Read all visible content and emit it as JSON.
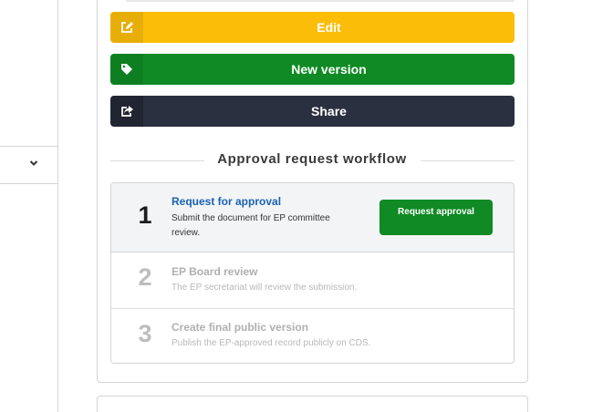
{
  "actions": {
    "edit_label": "Edit",
    "new_version_label": "New version",
    "share_label": "Share"
  },
  "workflow": {
    "title": "Approval request workflow",
    "steps": [
      {
        "number": "1",
        "title": "Request for approval",
        "description": "Submit the document for EP committee review.",
        "button_label": "Request approval"
      },
      {
        "number": "2",
        "title": "EP Board review",
        "description": "The EP secretariat will review the submission."
      },
      {
        "number": "3",
        "title": "Create final public version",
        "description": "Publish the EP-approved record publicly on CDS."
      }
    ]
  },
  "icons": {
    "edit": "edit-icon",
    "tag": "tag-icon",
    "share": "share-icon",
    "dropdown": "chevron-down-icon"
  },
  "colors": {
    "edit": "#fbbd08",
    "new_version": "#0f8a24",
    "share": "#2b3040",
    "link": "#1a62b5"
  }
}
